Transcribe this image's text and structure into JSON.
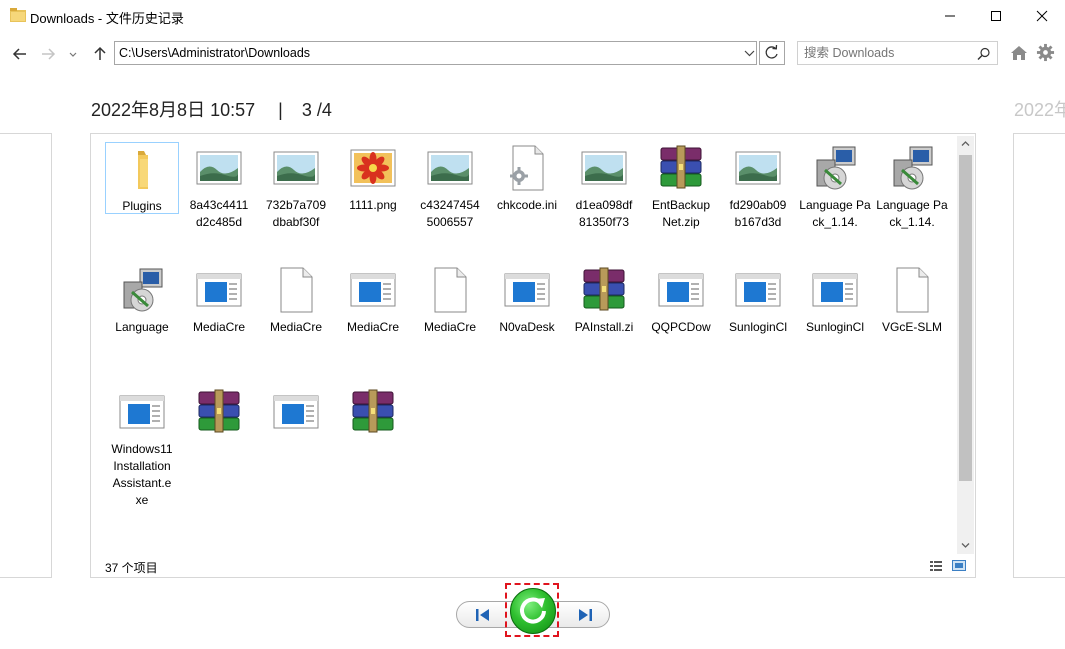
{
  "window": {
    "title": "Downloads - 文件历史记录",
    "minimize_label": "minimize",
    "maximize_label": "maximize",
    "close_label": "close"
  },
  "nav": {
    "address": "C:\\Users\\Administrator\\Downloads",
    "search_placeholder": "搜索 Downloads"
  },
  "header": {
    "date": "2022年8月8日 10:57",
    "separator": "|",
    "page": "3 /4",
    "ghost_date": "2022年"
  },
  "files": [
    {
      "name": "Plugins",
      "icon": "folder-icon",
      "type": "folder"
    },
    {
      "name": "8a43c4411d2c485d",
      "icon": "image-file-icon",
      "type": "image"
    },
    {
      "name": "732b7a709dbabf30f",
      "icon": "image-file-icon",
      "type": "image"
    },
    {
      "name": "1111.png",
      "icon": "png-flower-icon",
      "type": "png"
    },
    {
      "name": "c432474545006557",
      "icon": "image-file-icon",
      "type": "image"
    },
    {
      "name": "chkcode.ini",
      "icon": "ini-settings-icon",
      "type": "ini"
    },
    {
      "name": "d1ea098df81350f73",
      "icon": "image-file-icon",
      "type": "image"
    },
    {
      "name": "EntBackupNet.zip",
      "icon": "winrar-archive-icon",
      "type": "zip"
    },
    {
      "name": "fd290ab09b167d3d",
      "icon": "image-file-icon",
      "type": "image"
    },
    {
      "name": "Language Pack_1.14.",
      "icon": "installer-icon",
      "type": "installer"
    },
    {
      "name": "Language Pack_1.14.",
      "icon": "installer-icon",
      "type": "installer"
    },
    {
      "name": "Language",
      "icon": "installer-icon",
      "type": "installer"
    },
    {
      "name": "MediaCre",
      "icon": "exe-window-icon",
      "type": "exe"
    },
    {
      "name": "MediaCre",
      "icon": "blank-file-icon",
      "type": "file"
    },
    {
      "name": "MediaCre",
      "icon": "exe-window-icon",
      "type": "exe"
    },
    {
      "name": "MediaCre",
      "icon": "blank-file-icon",
      "type": "file"
    },
    {
      "name": "N0vaDesk",
      "icon": "exe-window-icon",
      "type": "exe"
    },
    {
      "name": "PAInstall.zi",
      "icon": "winrar-archive-icon",
      "type": "zip"
    },
    {
      "name": "QQPCDow",
      "icon": "exe-window-icon",
      "type": "exe"
    },
    {
      "name": "SunloginCl",
      "icon": "exe-window-icon",
      "type": "exe"
    },
    {
      "name": "SunloginCl",
      "icon": "exe-window-icon",
      "type": "exe"
    },
    {
      "name": "VGcE-SLM",
      "icon": "blank-file-icon",
      "type": "file"
    },
    {
      "name": "Windows11InstallationAssistant.exe",
      "icon": "exe-window-icon",
      "type": "exe"
    },
    {
      "name": "",
      "icon": "winrar-archive-icon",
      "type": "zip"
    },
    {
      "name": "",
      "icon": "exe-window-icon",
      "type": "exe"
    },
    {
      "name": "",
      "icon": "winrar-archive-icon",
      "type": "zip"
    }
  ],
  "status": {
    "count": "37 个项目"
  },
  "controls": {
    "previous": "previous-version",
    "restore": "restore",
    "next": "next-version"
  },
  "colors": {
    "restore_green": "#2fbf2f",
    "highlight_dash": "#e0141e",
    "selection_border": "#99d1ff"
  }
}
